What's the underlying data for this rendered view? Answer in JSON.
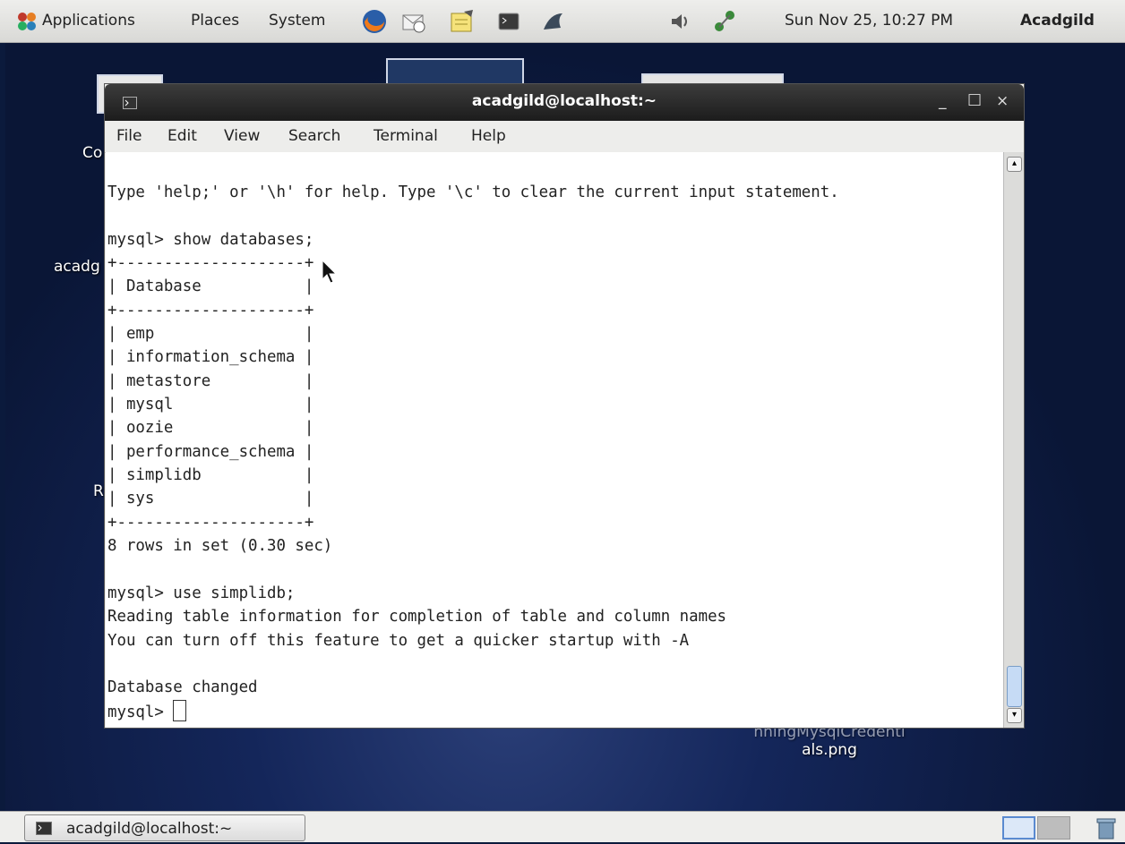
{
  "top_panel": {
    "menus": [
      "Applications",
      "Places",
      "System"
    ],
    "clock": "Sun Nov 25, 10:27 PM",
    "user": "Acadgild"
  },
  "desktop": {
    "fragments": [
      "Co",
      "acadg",
      "R"
    ],
    "file_label_line1": "nningMysqlCredenti",
    "file_label_line2": "als.png"
  },
  "terminal": {
    "title": "acadgild@localhost:~",
    "menu": [
      "File",
      "Edit",
      "View",
      "Search",
      "Terminal",
      "Help"
    ],
    "lines": [
      "Type 'help;' or '\\h' for help. Type '\\c' to clear the current input statement.",
      "",
      "mysql> show databases;",
      "+--------------------+",
      "| Database           |",
      "+--------------------+",
      "| emp                |",
      "| information_schema |",
      "| metastore          |",
      "| mysql              |",
      "| oozie              |",
      "| performance_schema |",
      "| simplidb           |",
      "| sys                |",
      "+--------------------+",
      "8 rows in set (0.30 sec)",
      "",
      "mysql> use simplidb;",
      "Reading table information for completion of table and column names",
      "You can turn off this feature to get a quicker startup with -A",
      "",
      "Database changed"
    ],
    "prompt": "mysql> "
  },
  "taskbar": {
    "task_label": "acadgild@localhost:~"
  }
}
